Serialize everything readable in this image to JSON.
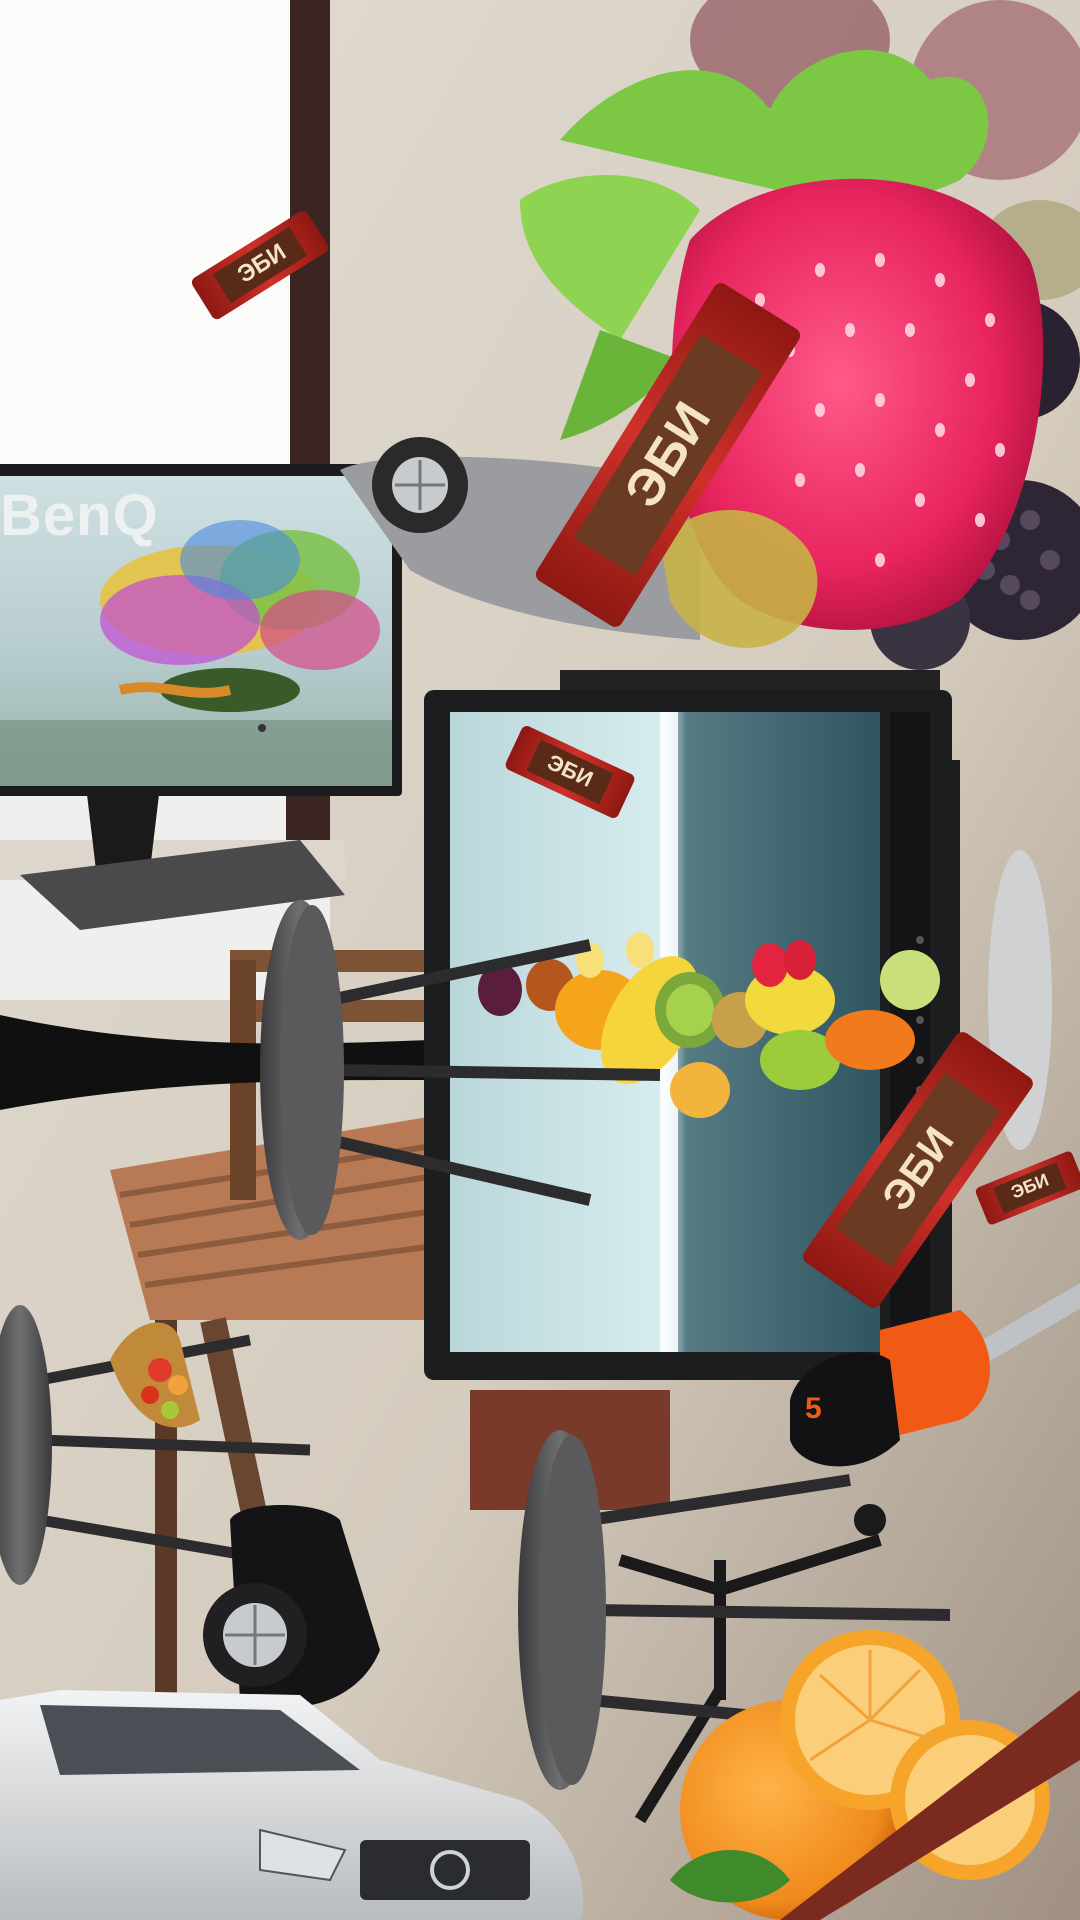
{
  "scene": {
    "title": "",
    "background_color": "#d8d0c4",
    "objects": [
      "window",
      "monitor",
      "monitor",
      "wafer-bar",
      "wafer-bar",
      "wafer-bar",
      "wafer-bar",
      "wafer-bar",
      "strawberry",
      "blackberries",
      "fruit-cluster",
      "fruit-basket",
      "stool",
      "stool",
      "stool",
      "car",
      "car",
      "car",
      "screwdriver",
      "orange",
      "wooden-table",
      "trumpet-bell",
      "office-chair"
    ]
  },
  "monitor_left": {
    "brand_label": "BenQ"
  },
  "wafer_bars": [
    {
      "label": "ЭБИ"
    },
    {
      "label": "ЭБИ"
    },
    {
      "label": "ЭБИ"
    },
    {
      "label": "ЭБИ"
    },
    {
      "label": "ЭБИ"
    }
  ],
  "screwdriver": {
    "label": "5"
  },
  "colors": {
    "wall": "#d8d0c4",
    "window_frame": "#3a2522",
    "wood": "#a86b48",
    "strawberry": "#e8245e",
    "wafer_wrapper": "#b8231d",
    "orange": "#f08a1c",
    "screwdriver_handle": "#f05a14",
    "car_silver": "#d8dadc"
  }
}
